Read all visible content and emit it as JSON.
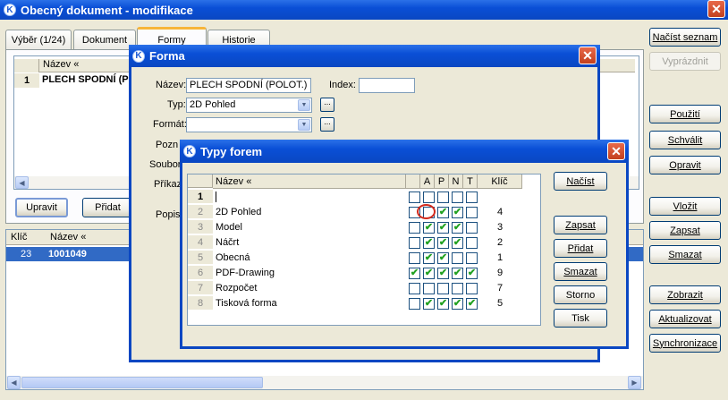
{
  "main_window": {
    "title": "Obecný dokument - modifikace",
    "tabs": [
      {
        "label": "Výběr (1/24)"
      },
      {
        "label": "Dokument"
      },
      {
        "label": "Formy"
      },
      {
        "label": "Historie"
      }
    ],
    "grid1": {
      "header": "Název «",
      "row_num": "1",
      "row_value": "PLECH SPODNÍ (PO"
    },
    "buttons_left": {
      "edit": "Upravit",
      "add": "Přidat"
    },
    "grid2": {
      "headers": [
        "Klíč",
        "Název «"
      ],
      "row": {
        "key": "23",
        "name": "1001049"
      }
    },
    "right_buttons": [
      {
        "label": "Načíst seznam"
      },
      {
        "label": "Vyprázdnit"
      },
      {
        "label": "Použití"
      },
      {
        "label": "Schválit"
      },
      {
        "label": "Opravit"
      },
      {
        "label": "Vložit"
      },
      {
        "label": "Zapsat"
      },
      {
        "label": "Smazat"
      },
      {
        "label": "Zobrazit"
      },
      {
        "label": "Aktualizovat"
      },
      {
        "label": "Synchronizace"
      }
    ]
  },
  "forma_dialog": {
    "title": "Forma",
    "labels": {
      "nazev": "Název:",
      "index": "Index:",
      "typ": "Typ:",
      "format": "Formát:",
      "pozn": "Pozn",
      "soubor": "Soubor",
      "prikaz": "Příkaz",
      "popis": "Popis"
    },
    "values": {
      "nazev": "PLECH SPODNÍ (POLOT.)",
      "index": "",
      "typ": "2D Pohled",
      "format": "",
      "dots": "..."
    }
  },
  "typy_dialog": {
    "title": "Typy forem",
    "columns": {
      "name": "Název «",
      "a": "A",
      "p": "P",
      "n": "N",
      "t": "T",
      "key": "Klíč"
    },
    "rows": [
      {
        "num": "1",
        "name": "",
        "key": "",
        "c0": false,
        "a": false,
        "p": false,
        "n": false,
        "t": false
      },
      {
        "num": "2",
        "name": "2D Pohled",
        "key": "4",
        "c0": false,
        "a": false,
        "p": true,
        "n": true,
        "t": false
      },
      {
        "num": "3",
        "name": "Model",
        "key": "3",
        "c0": false,
        "a": true,
        "p": true,
        "n": true,
        "t": false
      },
      {
        "num": "4",
        "name": "Náčrt",
        "key": "2",
        "c0": false,
        "a": true,
        "p": true,
        "n": true,
        "t": false
      },
      {
        "num": "5",
        "name": "Obecná",
        "key": "1",
        "c0": false,
        "a": true,
        "p": true,
        "n": false,
        "t": false
      },
      {
        "num": "6",
        "name": "PDF-Drawing",
        "key": "9",
        "c0": true,
        "a": true,
        "p": true,
        "n": true,
        "t": true
      },
      {
        "num": "7",
        "name": "Rozpočet",
        "key": "7",
        "c0": false,
        "a": false,
        "p": false,
        "n": false,
        "t": false
      },
      {
        "num": "8",
        "name": "Tisková forma",
        "key": "5",
        "c0": false,
        "a": true,
        "p": true,
        "n": true,
        "t": true
      }
    ],
    "buttons": [
      {
        "label": "Načíst"
      },
      {
        "label": "Zapsat"
      },
      {
        "label": "Přidat"
      },
      {
        "label": "Smazat"
      },
      {
        "label": "Storno"
      },
      {
        "label": "Tisk"
      }
    ],
    "highlight_color": "#d42a1c"
  },
  "colors": {
    "titlebar": "#0a4fd6",
    "selection": "#316ac5",
    "window_bg": "#ece9d8"
  }
}
